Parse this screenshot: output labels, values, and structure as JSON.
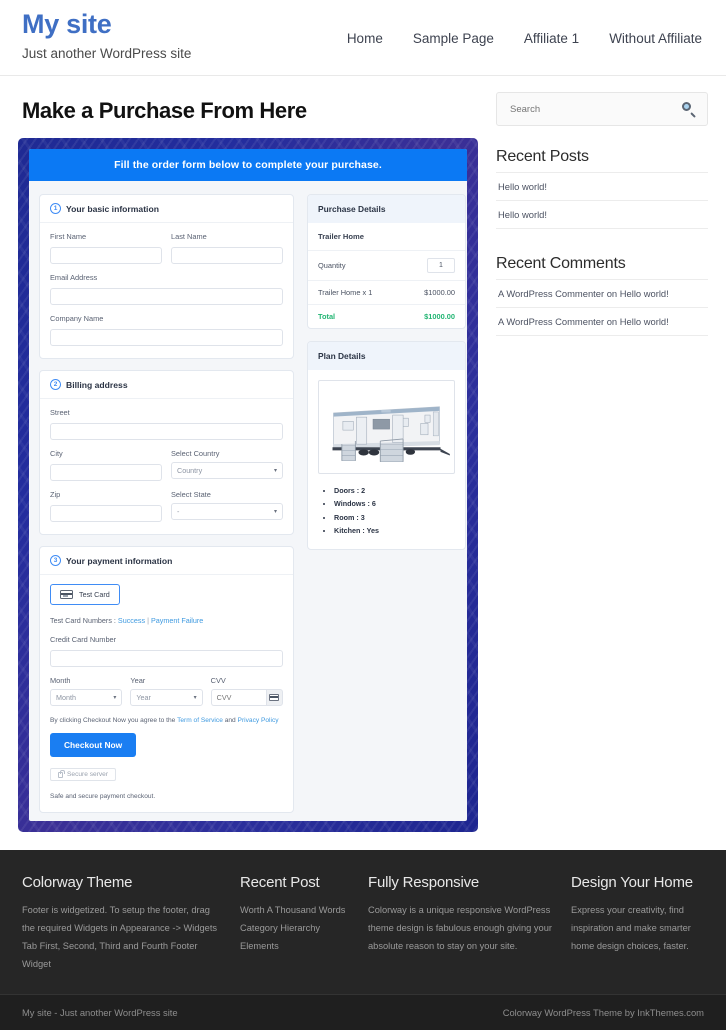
{
  "header": {
    "site_title": "My site",
    "tagline": "Just another WordPress site",
    "nav": [
      {
        "label": "Home"
      },
      {
        "label": "Sample Page"
      },
      {
        "label": "Affiliate 1"
      },
      {
        "label": "Without Affiliate"
      }
    ]
  },
  "main": {
    "page_title": "Make a Purchase From Here",
    "order_form": {
      "banner": "Fill the order form below to complete your purchase.",
      "step1": {
        "number": "1",
        "title": "Your basic information",
        "first_name_label": "First Name",
        "first_name_value": "",
        "last_name_label": "Last Name",
        "last_name_value": "",
        "email_label": "Email Address",
        "email_value": "",
        "company_label": "Company Name",
        "company_value": ""
      },
      "step2": {
        "number": "2",
        "title": "Billing address",
        "street_label": "Street",
        "street_value": "",
        "city_label": "City",
        "city_value": "",
        "country_label": "Select Country",
        "country_selected": "Country",
        "zip_label": "Zip",
        "zip_value": "",
        "state_label": "Select State",
        "state_selected": "-"
      },
      "step3": {
        "number": "3",
        "title": "Your payment information",
        "test_card_button": "Test Card",
        "test_numbers_prefix": "Test Card Numbers : ",
        "test_success_link": "Success",
        "test_separator": " | ",
        "test_failure_link": "Payment Failure",
        "card_number_label": "Credit Card Number",
        "card_number_value": "",
        "month_label": "Month",
        "month_selected": "Month",
        "year_label": "Year",
        "year_selected": "Year",
        "cvv_label": "CVV",
        "cvv_placeholder": "CVV",
        "terms_prefix": "By clicking Checkout Now you agree to the ",
        "terms_link": "Term of Service",
        "terms_middle": " and ",
        "privacy_link": "Privacy Policy",
        "checkout_button": "Checkout Now",
        "secure_badge": "Secure server",
        "safe_note": "Safe and secure payment checkout."
      },
      "purchase_details": {
        "title": "Purchase Details",
        "item_name": "Trailer Home",
        "quantity_label": "Quantity",
        "quantity_value": "1",
        "line_item_label": "Trailer Home x 1",
        "line_item_amount": "$1000.00",
        "total_label": "Total",
        "total_amount": "$1000.00"
      },
      "plan_details": {
        "title": "Plan Details",
        "image_alt": "trailer-home-photo",
        "features": [
          "Doors : 2",
          "Windows : 6",
          "Room : 3",
          "Kitchen : Yes"
        ]
      }
    }
  },
  "sidebar": {
    "search_placeholder": "Search",
    "search_value": "",
    "widgets": [
      {
        "title": "Recent Posts",
        "items": [
          "Hello world!",
          "Hello world!"
        ]
      },
      {
        "title": "Recent Comments",
        "items": [
          "A WordPress Commenter on Hello world!",
          "A WordPress Commenter on Hello world!"
        ]
      }
    ]
  },
  "footer": {
    "columns": [
      {
        "title": "Colorway Theme",
        "text": "Footer is widgetized. To setup the footer, drag the required Widgets in Appearance -> Widgets Tab First, Second, Third and Fourth Footer Widget"
      },
      {
        "title": "Recent Post",
        "items": [
          "Worth A Thousand Words",
          "Category Hierarchy",
          "Elements"
        ]
      },
      {
        "title": "Fully Responsive",
        "text": "Colorway is a unique responsive WordPress theme design is fabulous enough giving your absolute reason to stay on your site."
      },
      {
        "title": "Design Your Home",
        "text": "Express your creativity, find inspiration and make smarter home design choices, faster."
      }
    ],
    "bottom_left": "My site - Just another WordPress site",
    "bottom_right": "Colorway WordPress Theme by InkThemes.com"
  },
  "colors": {
    "brand_blue": "#3f6fc4",
    "banner_blue": "#0b79f4",
    "button_blue": "#1a7ef2",
    "accent_link": "#3f9ae0",
    "total_green": "#22b573",
    "footer_bg": "#262626",
    "footer_bottom_bg": "#1f1f1f"
  }
}
